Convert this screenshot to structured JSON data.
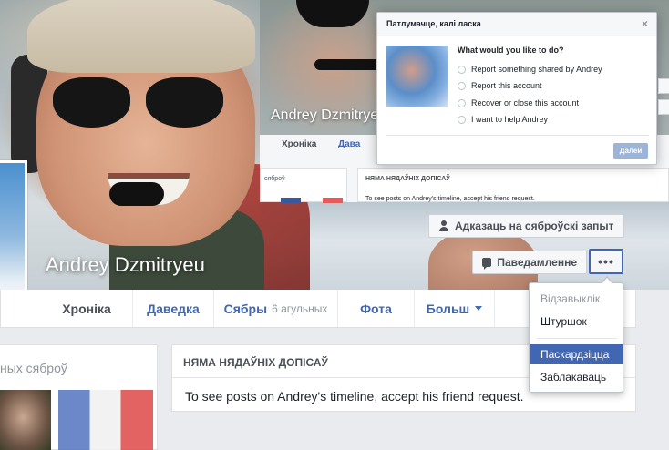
{
  "profile": {
    "name": "Andrey Dzmitryeu",
    "name_faded": "Andrey Dzmitryeu"
  },
  "cover_buttons": {
    "friend_request": "Адказаць на сяброўскі запыт",
    "message": "Паведамленне",
    "more": "•••"
  },
  "tabs": [
    {
      "label": "Хроніка",
      "active": true
    },
    {
      "label": "Даведка"
    },
    {
      "label": "Сябры",
      "count": "6 агульных"
    },
    {
      "label": "Фота"
    },
    {
      "label": "Больш"
    }
  ],
  "friends_card": {
    "title": "ных сяброў"
  },
  "posts": {
    "header": "НЯМА НЯДАЎНІХ ДОПІСАЎ",
    "message": "To see posts on Andrey's timeline, accept his friend request."
  },
  "dropdown": {
    "items": [
      {
        "label": "Відзавыклік",
        "state": "disabled"
      },
      {
        "label": "Штуршок",
        "state": "normal"
      },
      {
        "label": "Паскардзіцца",
        "state": "highlighted"
      },
      {
        "label": "Заблакаваць",
        "state": "normal"
      }
    ]
  },
  "report_dialog": {
    "title": "Патлумачце, калі ласка",
    "close": "×",
    "question": "What would you like to do?",
    "options": [
      "Report something shared by Andrey",
      "Report this account",
      "Recover or close this account",
      "I want to help Andrey"
    ],
    "next_button": "Далей"
  },
  "background_strip": {
    "tab_timeline": "Хроніка",
    "tab_about": "Дава",
    "left_title": "сяброў",
    "panel_header": "НЯМА НЯДАЎНІХ ДОПІСАЎ",
    "panel_body": "To see posts on Andrey's timeline, accept his friend request."
  },
  "colors": {
    "accent": "#4267b2",
    "page_bg": "#e9ebee",
    "highlight": "#4267b2"
  }
}
